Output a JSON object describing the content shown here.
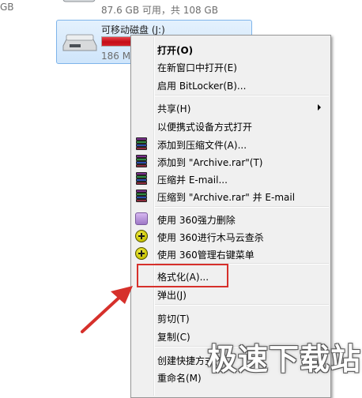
{
  "explorer": {
    "stray_text": "GB",
    "drive_c": {
      "space": "87.6 GB 可用，共 108 GB"
    },
    "drive_j": {
      "name": "可移动磁盘 (J:)",
      "size_partial": "186 M",
      "usage_fraction": 0.97,
      "bar_color": "#c8101a"
    }
  },
  "context_menu": {
    "items": [
      {
        "label": "打开(O)",
        "bold": true
      },
      {
        "label": "在新窗口中打开(E)"
      },
      {
        "label": "启用 BitLocker(B)..."
      },
      {
        "label": "共享(H)",
        "submenu": true
      },
      {
        "label": "以便携式设备方式打开"
      },
      {
        "label": "添加到压缩文件(A)...",
        "icon": "winrar-icon"
      },
      {
        "label": "添加到 \"Archive.rar\"(T)",
        "icon": "winrar-icon"
      },
      {
        "label": "压缩并 E-mail...",
        "icon": "winrar-icon"
      },
      {
        "label": "压缩到 \"Archive.rar\" 并 E-mail",
        "icon": "winrar-icon"
      },
      {
        "label": "使用 360强力删除",
        "icon": "360-delete-icon"
      },
      {
        "label": "使用 360进行木马云查杀",
        "icon": "360-icon"
      },
      {
        "label": "使用 360管理右键菜单",
        "icon": "360-icon"
      },
      {
        "label": "格式化(A)...",
        "highlighted": true
      },
      {
        "label": "弹出(J)"
      },
      {
        "label": "剪切(T)"
      },
      {
        "label": "复制(C)"
      },
      {
        "label": "创建快捷方式(S)"
      },
      {
        "label": "重命名(M)"
      }
    ]
  },
  "annotation": {
    "highlight_color": "#d6302b"
  },
  "watermark": {
    "text": "极速下载站"
  }
}
